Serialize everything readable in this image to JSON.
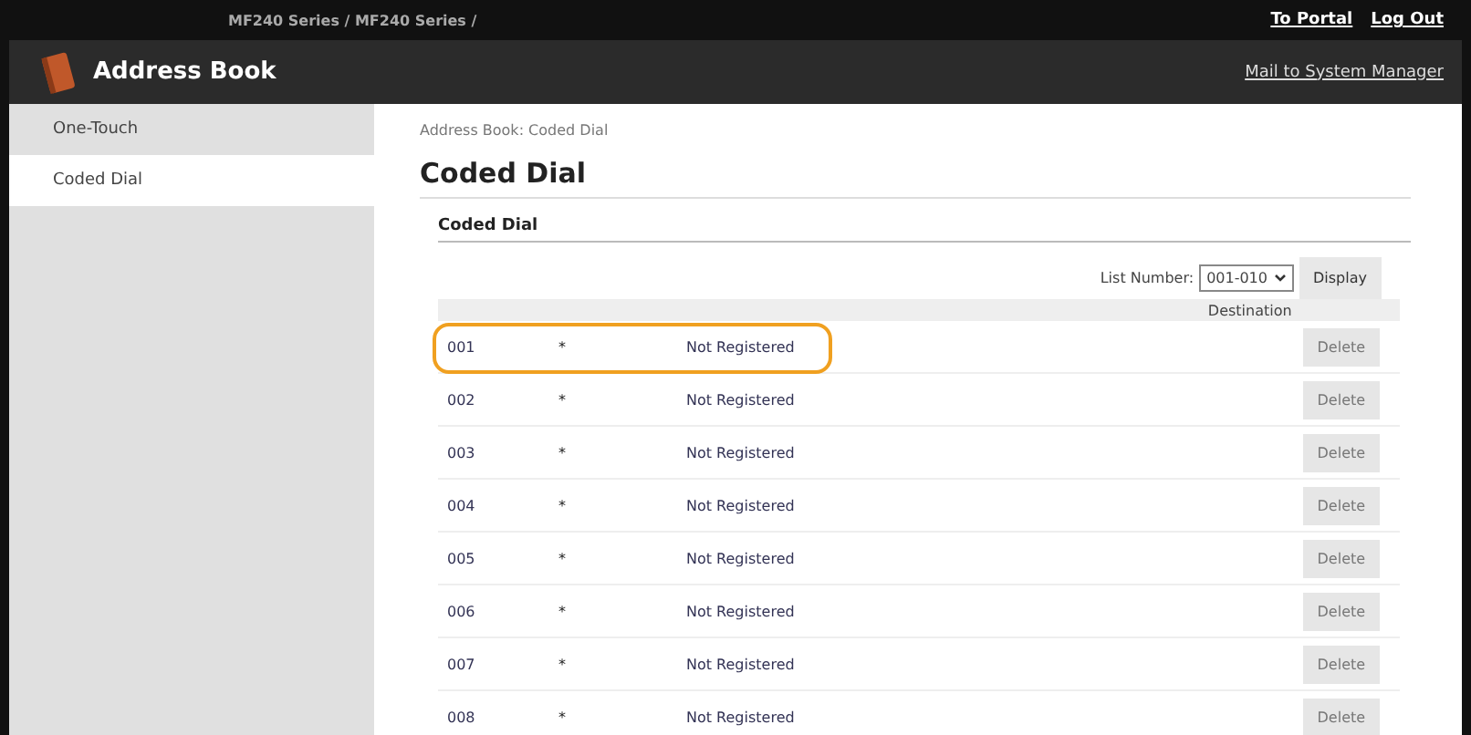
{
  "top_bar": {
    "path": "MF240 Series / MF240 Series /",
    "links": [
      "To Portal",
      "Log Out"
    ]
  },
  "header": {
    "title": "Address Book",
    "link": "Mail to System Manager"
  },
  "sidebar": {
    "items": [
      {
        "label": "One-Touch",
        "selected": false
      },
      {
        "label": "Coded Dial",
        "selected": true
      }
    ]
  },
  "breadcrumb": "Address Book: Coded Dial",
  "page_title": "Coded Dial",
  "section_title": "Coded Dial",
  "list_number": {
    "label": "List Number:",
    "value": "001-010",
    "button": "Display"
  },
  "table": {
    "columns": [
      "Destination"
    ],
    "rows": [
      {
        "number": "001",
        "type": "*",
        "name": "Not Registered",
        "button": "Delete",
        "disabled": true,
        "highlighted": true
      },
      {
        "number": "002",
        "type": "*",
        "name": "Not Registered",
        "button": "Delete",
        "disabled": true,
        "highlighted": false
      },
      {
        "number": "003",
        "type": "*",
        "name": "Not Registered",
        "button": "Delete",
        "disabled": true,
        "highlighted": false
      },
      {
        "number": "004",
        "type": "*",
        "name": "Not Registered",
        "button": "Delete",
        "disabled": true,
        "highlighted": false
      },
      {
        "number": "005",
        "type": "*",
        "name": "Not Registered",
        "button": "Delete",
        "disabled": true,
        "highlighted": false
      },
      {
        "number": "006",
        "type": "*",
        "name": "Not Registered",
        "button": "Delete",
        "disabled": true,
        "highlighted": false
      },
      {
        "number": "007",
        "type": "*",
        "name": "Not Registered",
        "button": "Delete",
        "disabled": true,
        "highlighted": false
      },
      {
        "number": "008",
        "type": "*",
        "name": "Not Registered",
        "button": "Delete",
        "disabled": true,
        "highlighted": false
      }
    ]
  }
}
